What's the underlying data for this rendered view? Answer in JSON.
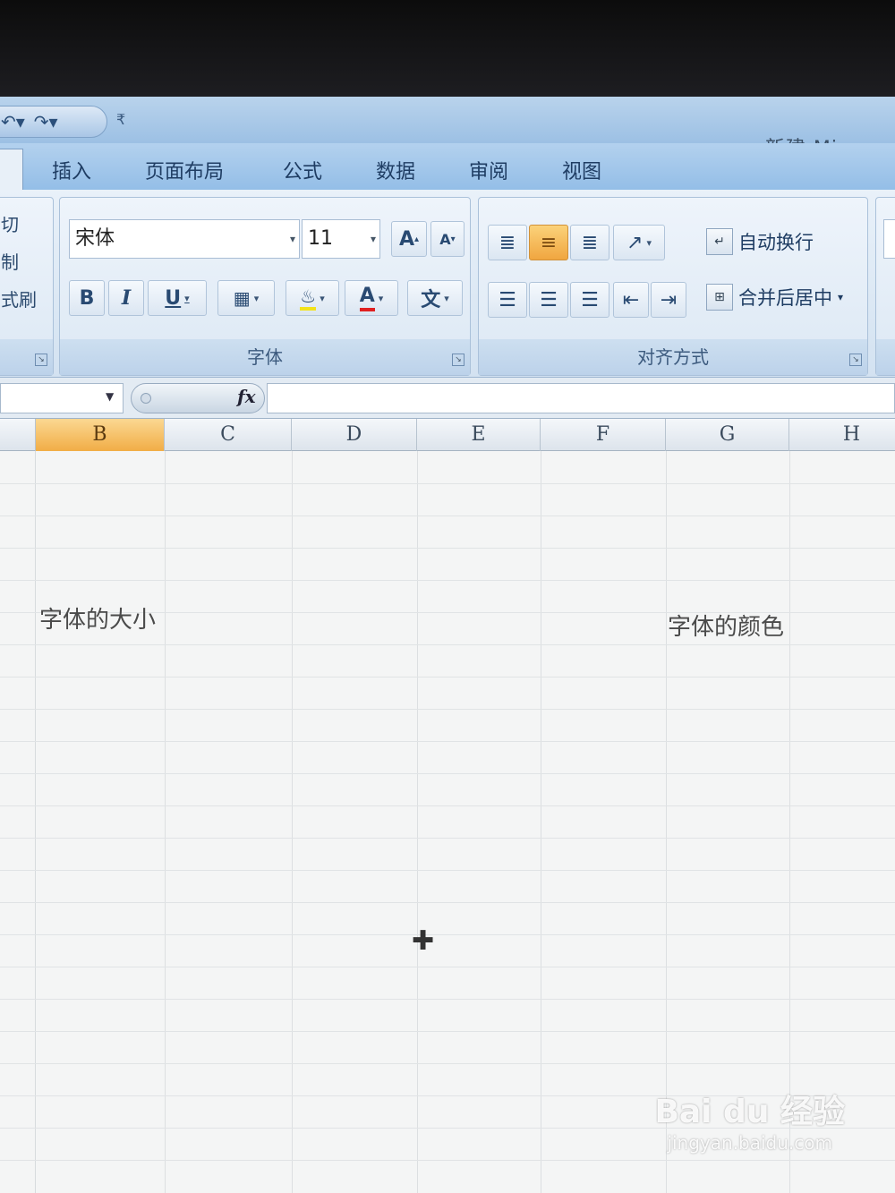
{
  "window": {
    "title": "新建 Microso"
  },
  "quick_access": {
    "undo_icon": "undo-icon",
    "redo_icon": "redo-icon",
    "more_symbol": "₹"
  },
  "tabs": [
    {
      "label": "插入"
    },
    {
      "label": "页面布局"
    },
    {
      "label": "公式"
    },
    {
      "label": "数据"
    },
    {
      "label": "审阅"
    },
    {
      "label": "视图"
    }
  ],
  "clipboard": {
    "items": [
      "切",
      "制",
      "式刷"
    ]
  },
  "font_group": {
    "label": "字体",
    "font_name": "宋体",
    "font_size": "11",
    "grow_font": "A",
    "shrink_font": "A",
    "bold": "B",
    "italic": "I",
    "underline": "U",
    "font_color": "A",
    "phonetic": "文"
  },
  "alignment_group": {
    "label": "对齐方式",
    "wrap_text": "自动换行",
    "merge_center": "合并后居中"
  },
  "formula_bar": {
    "fx_label": "fx",
    "name_box": "",
    "formula": ""
  },
  "columns": [
    {
      "label": "B",
      "active": true
    },
    {
      "label": "C"
    },
    {
      "label": "D"
    },
    {
      "label": "E"
    },
    {
      "label": "F"
    },
    {
      "label": "G"
    },
    {
      "label": "H"
    }
  ],
  "cells": {
    "b_text": "字体的大小",
    "g_text": "字体的颜色"
  },
  "watermark": {
    "main": "Bai du 经验",
    "sub": "jingyan.baidu.com"
  },
  "colors": {
    "ribbon_blue": "#b3d1ee",
    "active_orange": "#f1ad46"
  }
}
